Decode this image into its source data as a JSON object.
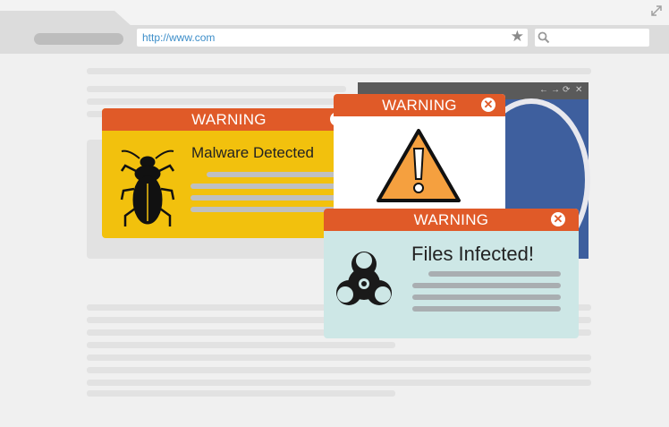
{
  "browser": {
    "url": "http://www.com",
    "icons": {
      "bookmark": "star-icon",
      "search": "search-icon",
      "expand": "expand-icon"
    }
  },
  "background_window": {
    "controls": [
      "←",
      "→",
      "⟳",
      "✕"
    ]
  },
  "popups": [
    {
      "title": "WARNING",
      "message": "Malware Detected",
      "icon": "cockroach-icon",
      "bg_color": "#f2c10d"
    },
    {
      "title": "WARNING",
      "icon": "warning-triangle-icon",
      "bg_color": "#ffffff"
    },
    {
      "title": "WARNING",
      "message": "Files Infected!",
      "icon": "biohazard-icon",
      "bg_color": "#cde7e6"
    }
  ],
  "colors": {
    "warning_bar": "#e05a28",
    "warning_triangle": "#f5a03f",
    "window_blue": "#3e5f9e"
  }
}
